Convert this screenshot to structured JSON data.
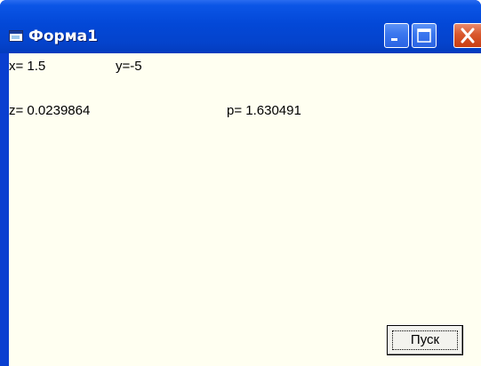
{
  "window": {
    "title": "Форма1"
  },
  "labels": {
    "x": "x= 1.5",
    "y": "y=-5",
    "z": "z= 0.0239864",
    "p": "p= 1.630491"
  },
  "buttons": {
    "start": "Пуск"
  },
  "colors": {
    "titlebar": "#0348d7",
    "client": "#fffff1",
    "close_button": "#d9582d"
  }
}
